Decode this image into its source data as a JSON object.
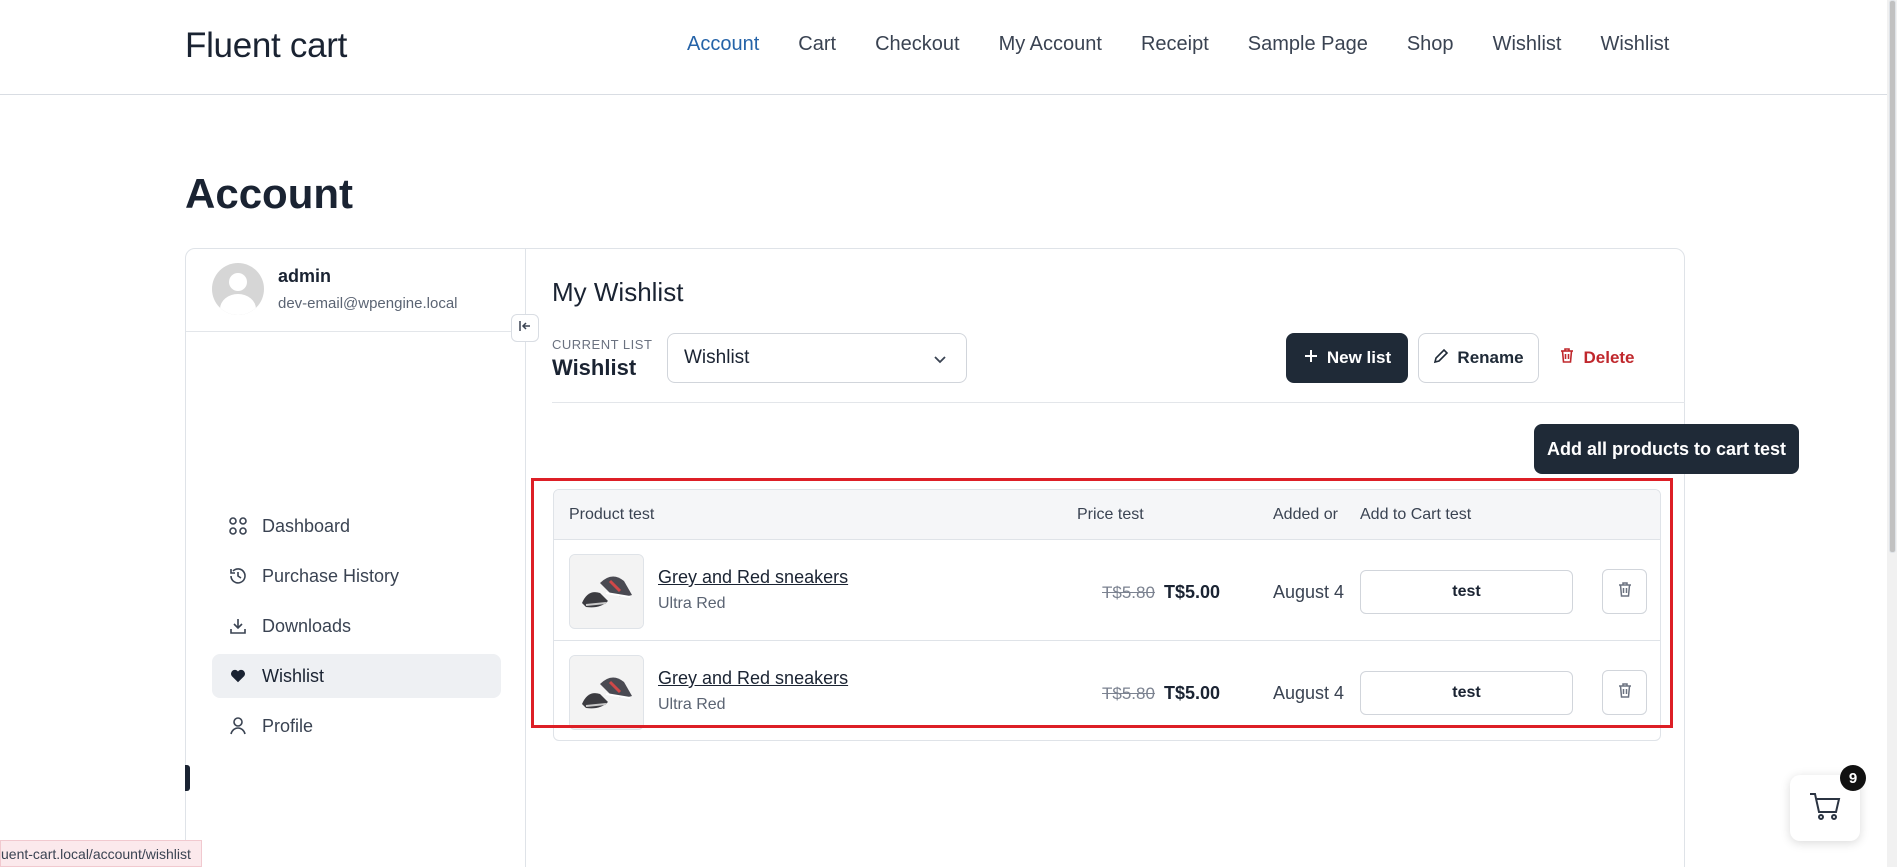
{
  "site": {
    "title": "Fluent cart"
  },
  "nav": [
    "Account",
    "Cart",
    "Checkout",
    "My Account",
    "Receipt",
    "Sample Page",
    "Shop",
    "Wishlist",
    "Wishlist"
  ],
  "page_title": "Account",
  "user": {
    "name": "admin",
    "email": "dev-email@wpengine.local"
  },
  "sidebar": {
    "items": [
      {
        "label": "Dashboard",
        "icon": "dashboard-icon"
      },
      {
        "label": "Purchase History",
        "icon": "history-icon"
      },
      {
        "label": "Downloads",
        "icon": "download-icon"
      },
      {
        "label": "Wishlist",
        "icon": "heart-icon",
        "active": true
      },
      {
        "label": "Profile",
        "icon": "user-icon"
      }
    ]
  },
  "wishlist": {
    "heading": "My Wishlist",
    "current_label": "Current list",
    "current_name": "Wishlist",
    "select_value": "Wishlist",
    "new_list": "New list",
    "rename": "Rename",
    "delete": "Delete",
    "add_all": "Add all products to cart test",
    "columns": {
      "product": "Product test",
      "price": "Price test",
      "added": "Added or",
      "add_to_cart": "Add to Cart test"
    },
    "rows": [
      {
        "name": "Grey and Red sneakers",
        "variant": "Ultra Red",
        "old_price": "T$5.80",
        "price": "T$5.00",
        "added": "August 4",
        "cart_label": "test"
      },
      {
        "name": "Grey and Red sneakers",
        "variant": "Ultra Red",
        "old_price": "T$5.80",
        "price": "T$5.00",
        "added": "August 4",
        "cart_label": "test"
      }
    ]
  },
  "cart": {
    "count": "9"
  },
  "status_bar": {
    "url": "uent-cart.local/account/wishlist"
  },
  "colors": {
    "accent": "#2563a8",
    "dark": "#1f2a37",
    "danger": "#c0282d",
    "highlight": "#dd1f26"
  }
}
